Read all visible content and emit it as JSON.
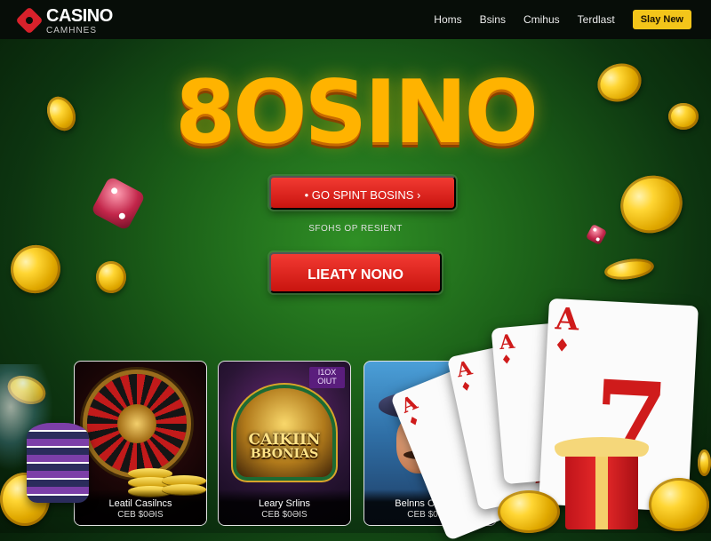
{
  "brand": {
    "name": "CASINO",
    "tagline": "CAMHNES"
  },
  "nav": {
    "items": [
      "Homs",
      "Bsins",
      "Cmihus",
      "Terdlast"
    ],
    "cta_label": "Slay New"
  },
  "hero": {
    "title": "8OSINO",
    "primary_cta": "• GO SPINT BOSINS ›",
    "subtext": "SFOHS OP RESIENT",
    "secondary_cta": "LIEATY NONO"
  },
  "games": [
    {
      "title": "Leatil Casilncs",
      "subtitle": "CEB $0ƏIS"
    },
    {
      "title": "Leary Srlins",
      "subtitle": "CEB $0ƏIS",
      "emblem_title": "CAIKIIN",
      "emblem_sub": "BBONIAS",
      "tag": "I1OX OIUT"
    },
    {
      "title": "Belnns Camiims",
      "subtitle": "CEB $0ƏIS"
    }
  ],
  "cards": {
    "rank": "A",
    "value": "7",
    "suit": "♦"
  },
  "colors": {
    "accent_gold": "#ffb300",
    "cta_red": "#e0221c",
    "nav_cta": "#f3c51a",
    "background_green": "#1b5f18"
  },
  "icons": [
    "logo-diamond-icon",
    "coin-icon",
    "die-icon",
    "roulette-icon",
    "playing-card-icon",
    "gift-icon",
    "poker-chips-icon"
  ]
}
